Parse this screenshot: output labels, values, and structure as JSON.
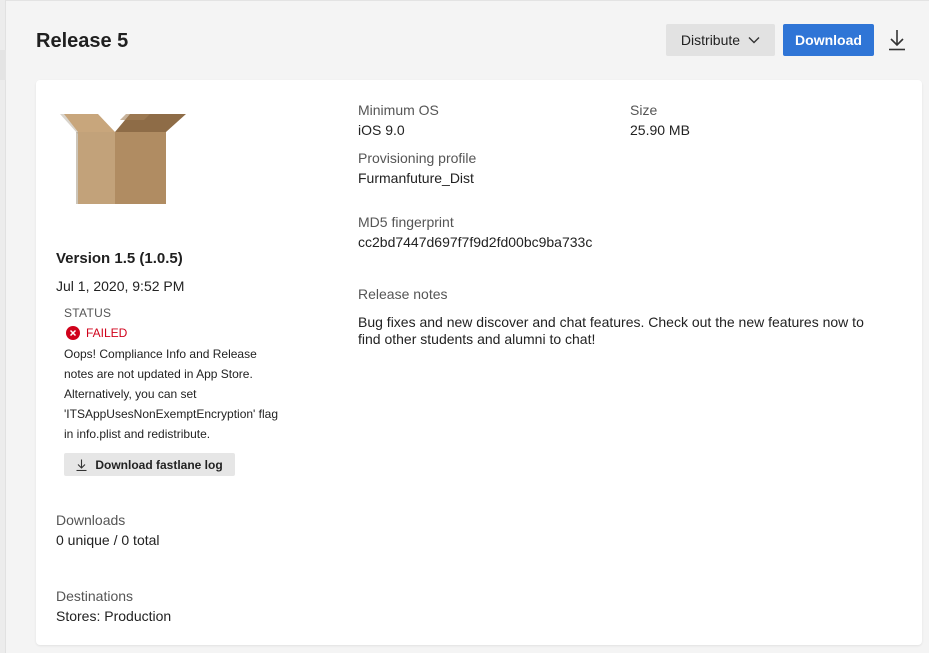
{
  "header": {
    "title": "Release 5",
    "distribute_label": "Distribute",
    "download_label": "Download"
  },
  "release": {
    "version": "Version 1.5 (1.0.5)",
    "date": "Jul 1, 2020, 9:52 PM",
    "status_label": "STATUS",
    "status_value": "FAILED",
    "status_message": "Oops! Compliance Info and Release notes are not updated in App Store. Alternatively, you can set 'ITSAppUsesNonExemptEncryption' flag in info.plist and redistribute.",
    "log_button_label": "Download fastlane log",
    "downloads_label": "Downloads",
    "downloads_value": "0 unique / 0 total",
    "destinations_label": "Destinations",
    "destinations_value": "Stores: Production"
  },
  "details": {
    "min_os_label": "Minimum OS",
    "min_os_value": "iOS 9.0",
    "size_label": "Size",
    "size_value": "25.90 MB",
    "profile_label": "Provisioning profile",
    "profile_value": "Furmanfuture_Dist",
    "md5_label": "MD5 fingerprint",
    "md5_value": "cc2bd7447d697f7f9d2fd00bc9ba733c",
    "notes_label": "Release notes",
    "notes_value": "Bug fixes and new discover and chat features. Check out the new features now to find other students and alumni to chat!"
  },
  "colors": {
    "primary": "#2f75d6",
    "failed": "#d0021b"
  },
  "icons": {
    "app": "package-box-icon",
    "download": "download-icon",
    "chevron": "chevron-down-icon",
    "failed": "error-circle-icon"
  }
}
